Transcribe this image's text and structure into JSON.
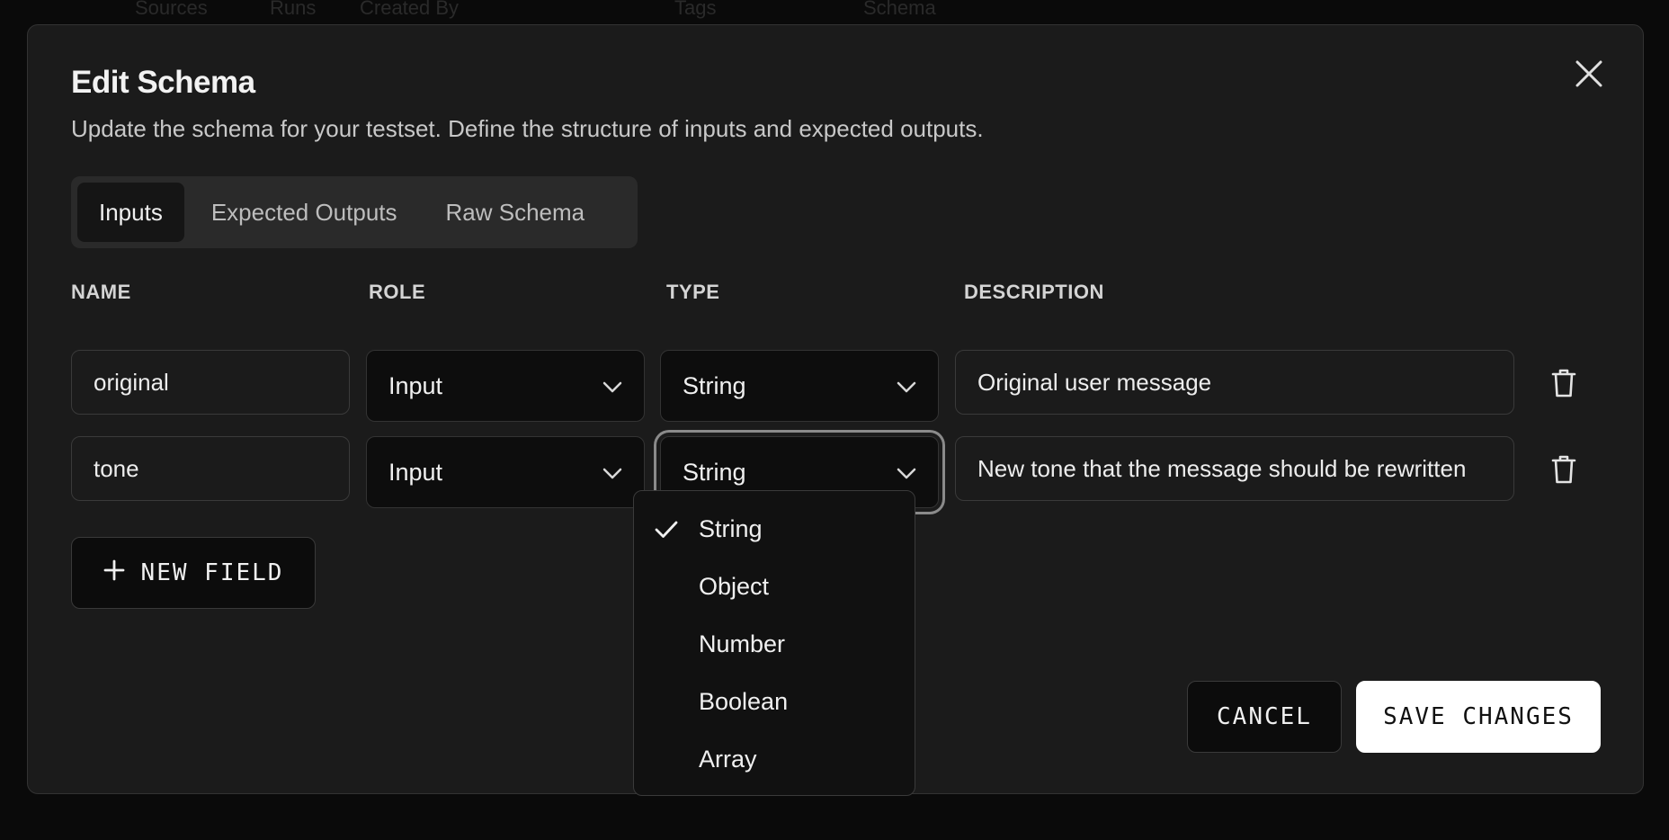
{
  "background_header": [
    "Sources",
    "Runs",
    "Created By",
    "Tags",
    "Schema"
  ],
  "modal": {
    "title": "Edit Schema",
    "subtitle": "Update the schema for your testset. Define the structure of inputs and expected outputs."
  },
  "tabs": [
    {
      "label": "Inputs",
      "active": true
    },
    {
      "label": "Expected Outputs",
      "active": false
    },
    {
      "label": "Raw Schema",
      "active": false
    }
  ],
  "columns": {
    "name": "NAME",
    "role": "ROLE",
    "type": "TYPE",
    "description": "DESCRIPTION"
  },
  "rows": [
    {
      "name": "original",
      "role": "Input",
      "type": "String",
      "description": "Original user message"
    },
    {
      "name": "tone",
      "role": "Input",
      "type": "String",
      "description": "New tone that the message should be rewritten"
    }
  ],
  "buttons": {
    "new_field": "NEW FIELD",
    "cancel": "CANCEL",
    "save": "SAVE CHANGES"
  },
  "type_dropdown": {
    "open_for_row": 2,
    "selected": "String",
    "options": [
      "String",
      "Object",
      "Number",
      "Boolean",
      "Array"
    ]
  },
  "icons": {
    "close": "close-icon",
    "chevron": "chevron-down-icon",
    "delete": "trash-icon",
    "add": "plus-icon",
    "selected": "check-icon"
  }
}
